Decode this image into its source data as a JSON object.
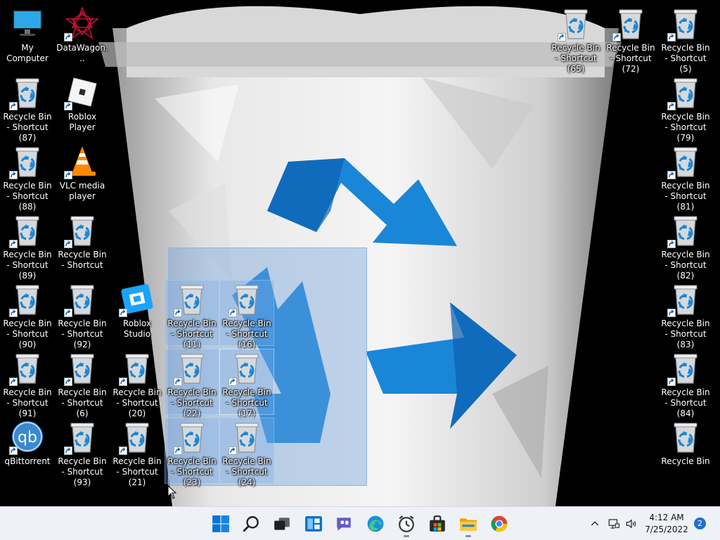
{
  "desktop": {
    "icons": [
      {
        "id": "my-computer",
        "label": "My Computer",
        "type": "monitor",
        "shortcut": false
      },
      {
        "id": "datawagon",
        "label": "DataWagon...",
        "type": "datawagon",
        "shortcut": true
      },
      {
        "id": "rb65",
        "label": "Recycle Bin - Shortcut (65)",
        "type": "recycle",
        "shortcut": true
      },
      {
        "id": "rb72",
        "label": "Recycle Bin - Shortcut (72)",
        "type": "recycle",
        "shortcut": true
      },
      {
        "id": "rb5",
        "label": "Recycle Bin - Shortcut (5)",
        "type": "recycle",
        "shortcut": true
      },
      {
        "id": "rb87",
        "label": "Recycle Bin - Shortcut (87)",
        "type": "recycle",
        "shortcut": true
      },
      {
        "id": "roblox-player",
        "label": "Roblox Player",
        "type": "roblox",
        "shortcut": true
      },
      {
        "id": "rb79",
        "label": "Recycle Bin - Shortcut (79)",
        "type": "recycle",
        "shortcut": true
      },
      {
        "id": "rb88",
        "label": "Recycle Bin - Shortcut (88)",
        "type": "recycle",
        "shortcut": true
      },
      {
        "id": "vlc",
        "label": "VLC media player",
        "type": "vlc",
        "shortcut": true
      },
      {
        "id": "rb81",
        "label": "Recycle Bin - Shortcut (81)",
        "type": "recycle",
        "shortcut": true
      },
      {
        "id": "rb89",
        "label": "Recycle Bin - Shortcut (89)",
        "type": "recycle",
        "shortcut": true
      },
      {
        "id": "rbs",
        "label": "Recycle Bin - Shortcut",
        "type": "recycle",
        "shortcut": true
      },
      {
        "id": "rb82",
        "label": "Recycle Bin - Shortcut (82)",
        "type": "recycle",
        "shortcut": true
      },
      {
        "id": "rb90",
        "label": "Recycle Bin - Shortcut (90)",
        "type": "recycle",
        "shortcut": true
      },
      {
        "id": "rb92",
        "label": "Recycle Bin - Shortcut (92)",
        "type": "recycle",
        "shortcut": true
      },
      {
        "id": "roblox-studio",
        "label": "Roblox Studio",
        "type": "studio",
        "shortcut": true
      },
      {
        "id": "rb11",
        "label": "Recycle Bin - Shortcut (11)",
        "type": "recycle",
        "shortcut": true
      },
      {
        "id": "rb16",
        "label": "Recycle Bin - Shortcut (16)",
        "type": "recycle",
        "shortcut": true
      },
      {
        "id": "rb83",
        "label": "Recycle Bin - Shortcut (83)",
        "type": "recycle",
        "shortcut": true
      },
      {
        "id": "rb91",
        "label": "Recycle Bin - Shortcut (91)",
        "type": "recycle",
        "shortcut": true
      },
      {
        "id": "rb6",
        "label": "Recycle Bin - Shortcut (6)",
        "type": "recycle",
        "shortcut": true
      },
      {
        "id": "rb20",
        "label": "Recycle Bin - Shortcut (20)",
        "type": "recycle",
        "shortcut": true
      },
      {
        "id": "rb22",
        "label": "Recycle Bin - Shortcut (22)",
        "type": "recycle",
        "shortcut": true
      },
      {
        "id": "rb17",
        "label": "Recycle Bin - Shortcut (17)",
        "type": "recycle",
        "shortcut": true
      },
      {
        "id": "rb84",
        "label": "Recycle Bin - Shortcut (84)",
        "type": "recycle",
        "shortcut": true
      },
      {
        "id": "qbittorrent",
        "label": "qBittorrent",
        "type": "qbit",
        "shortcut": true
      },
      {
        "id": "rb93",
        "label": "Recycle Bin - Shortcut (93)",
        "type": "recycle",
        "shortcut": true
      },
      {
        "id": "rb21",
        "label": "Recycle Bin - Shortcut (21)",
        "type": "recycle",
        "shortcut": true
      },
      {
        "id": "rb23",
        "label": "Recycle Bin - Shortcut (23)",
        "type": "recycle",
        "shortcut": true
      },
      {
        "id": "rb24",
        "label": "Recycle Bin - Shortcut (24)",
        "type": "recycle",
        "shortcut": true
      },
      {
        "id": "recycle-bin",
        "label": "Recycle Bin",
        "type": "recycle",
        "shortcut": false
      }
    ]
  },
  "taskbar": {
    "buttons": [
      {
        "name": "start-button",
        "icon": "windows-logo-icon"
      },
      {
        "name": "search-button",
        "icon": "search-icon"
      },
      {
        "name": "task-view-button",
        "icon": "task-view-icon"
      },
      {
        "name": "widgets-button",
        "icon": "widgets-icon"
      },
      {
        "name": "chat-button",
        "icon": "chat-icon"
      },
      {
        "name": "edge-button",
        "icon": "edge-icon"
      },
      {
        "name": "clock-app-button",
        "icon": "alarm-clock-icon"
      },
      {
        "name": "store-button",
        "icon": "store-icon"
      },
      {
        "name": "file-explorer-button",
        "icon": "folder-icon"
      },
      {
        "name": "chrome-button",
        "icon": "chrome-icon"
      }
    ],
    "tray": {
      "time": "4:12 AM",
      "date": "7/25/2022",
      "notification_count": "2"
    }
  },
  "colors": {
    "recycle_blue": "#1a86d8",
    "accent": "#0067c0",
    "taskbar_bg": "#eef1f5"
  }
}
